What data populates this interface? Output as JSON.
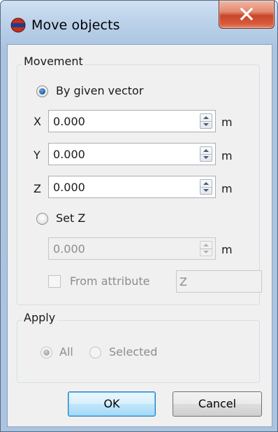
{
  "window": {
    "title": "Move objects",
    "close_glyph": "X"
  },
  "movement": {
    "group_label": "Movement",
    "by_vector_label": "By given vector",
    "fields": [
      {
        "axis": "X",
        "value": "0.000",
        "unit": "m"
      },
      {
        "axis": "Y",
        "value": "0.000",
        "unit": "m"
      },
      {
        "axis": "Z",
        "value": "0.000",
        "unit": "m"
      }
    ],
    "set_z_label": "Set Z",
    "set_z_value": "0.000",
    "set_z_unit": "m",
    "from_attribute_label": "From attribute",
    "attribute_value": "Z"
  },
  "apply": {
    "group_label": "Apply",
    "all_label": "All",
    "selected_label": "Selected"
  },
  "buttons": {
    "ok": "OK",
    "cancel": "Cancel"
  },
  "colors": {
    "accent_radio": "#2a6bb5",
    "close_button": "#c8462a",
    "dialog_bg": "#f0f0f0"
  }
}
